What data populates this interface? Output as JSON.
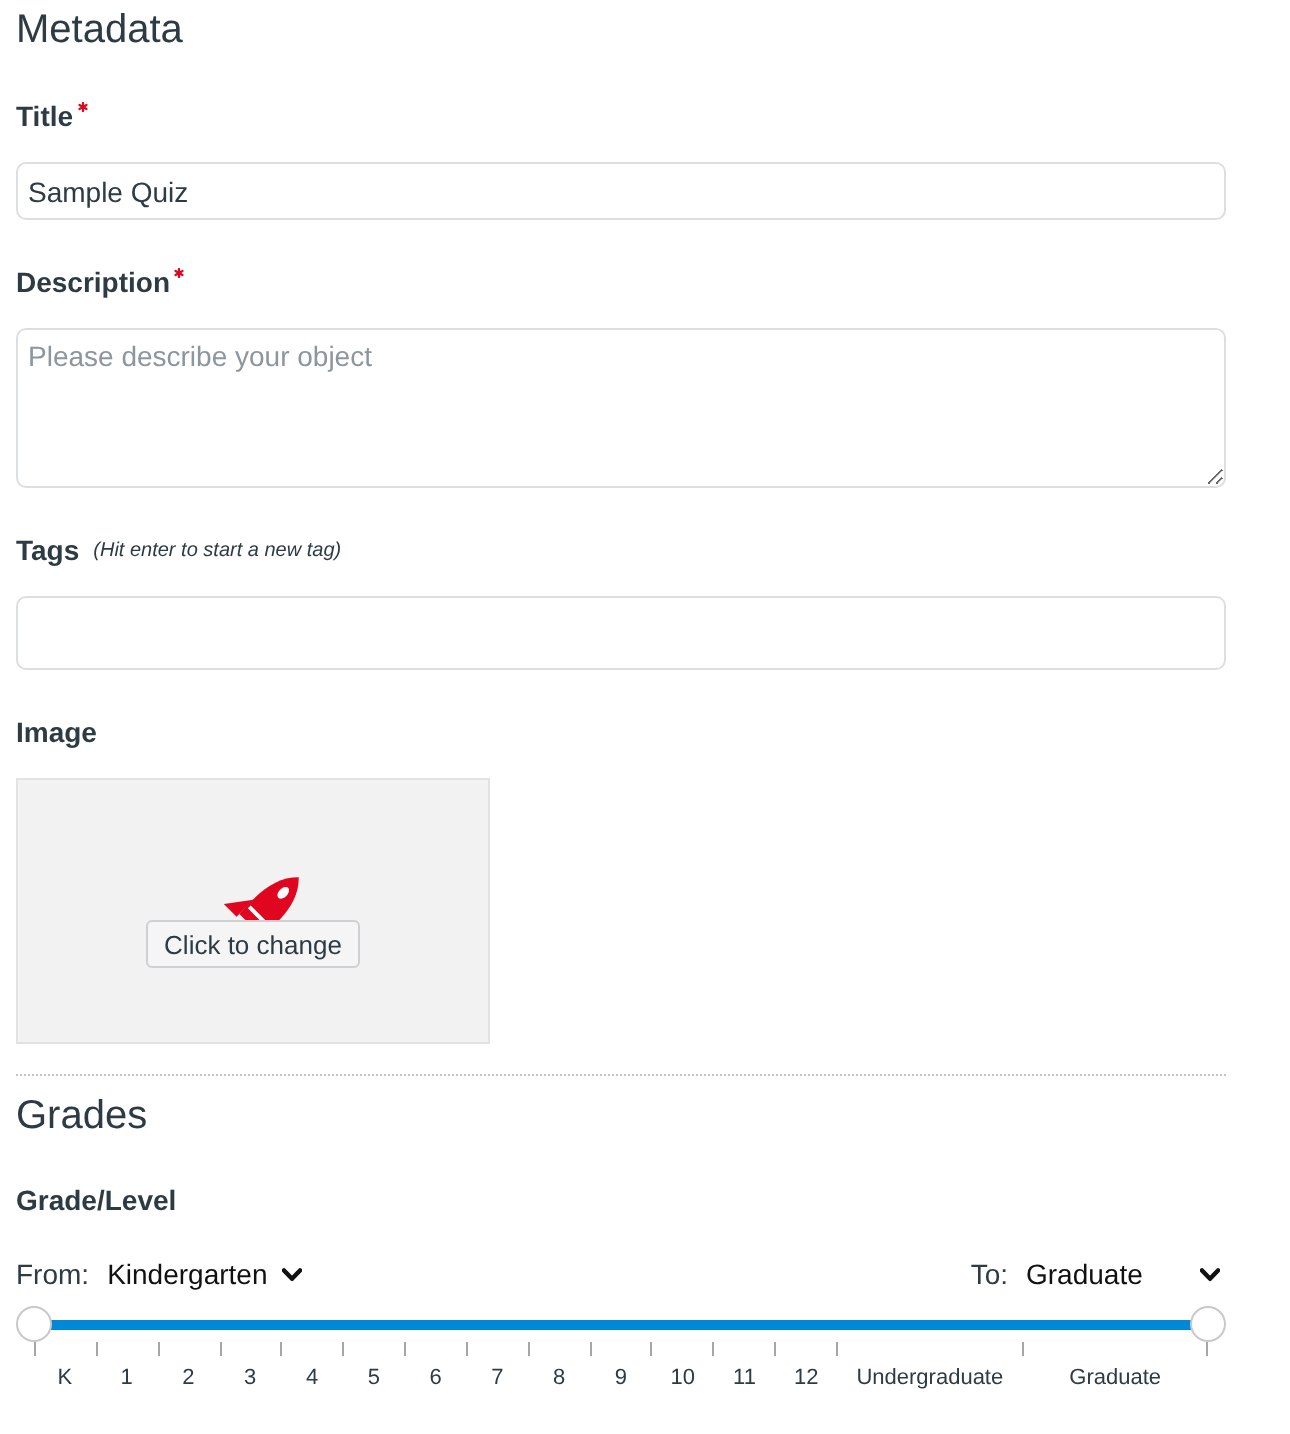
{
  "metadata": {
    "heading": "Metadata",
    "fields": [
      {
        "kind": "text",
        "label": "Title",
        "required": true,
        "value": "Sample Quiz"
      },
      {
        "kind": "textarea",
        "label": "Description",
        "required": true,
        "placeholder": "Please describe your object"
      },
      {
        "kind": "tags",
        "label": "Tags",
        "required": false,
        "hint": "(Hit enter to start a new tag)"
      },
      {
        "kind": "image",
        "label": "Image",
        "required": false,
        "button": "Click to change"
      }
    ]
  },
  "grades": {
    "heading": "Grades",
    "label": "Grade/Level",
    "from": {
      "label": "From:",
      "value": "Kindergarten",
      "level": 0
    },
    "to": {
      "label": "To:",
      "value": "Graduate",
      "level": 1
    },
    "scale": [
      {
        "label": "K",
        "kind": "grade"
      },
      {
        "label": "1",
        "kind": "grade"
      },
      {
        "label": "2",
        "kind": "grade"
      },
      {
        "label": "3",
        "kind": "grade"
      },
      {
        "label": "4",
        "kind": "grade"
      },
      {
        "label": "5",
        "kind": "grade"
      },
      {
        "label": "6",
        "kind": "grade"
      },
      {
        "label": "7",
        "kind": "grade"
      },
      {
        "label": "8",
        "kind": "grade"
      },
      {
        "label": "9",
        "kind": "grade"
      },
      {
        "label": "10",
        "kind": "grade"
      },
      {
        "label": "11",
        "kind": "grade"
      },
      {
        "label": "12",
        "kind": "grade"
      },
      {
        "label": "Undergraduate",
        "kind": "degree"
      },
      {
        "label": "Graduate",
        "kind": "degree"
      }
    ]
  }
}
